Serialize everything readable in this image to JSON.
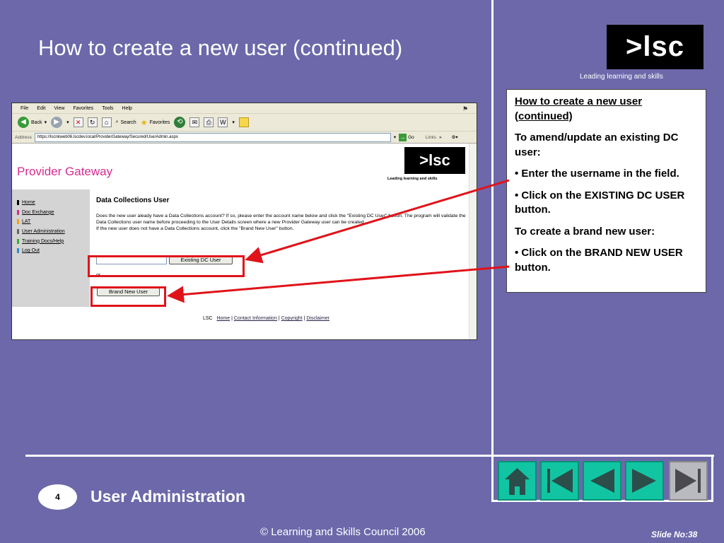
{
  "slide": {
    "title": "How to create a new user (continued)",
    "logo_text": ">lsc",
    "logo_tagline": "Leading learning and skills",
    "section_number": "4",
    "section_title": "User Administration",
    "copyright": "© Learning and Skills Council 2006",
    "slide_number": "Slide No:38"
  },
  "panel": {
    "heading": "How to create a new user (continued)",
    "amend_heading": "To amend/update an existing DC user:",
    "step1": "• Enter the username in the field.",
    "step2": "• Click on the EXISTING DC USER button.",
    "create_heading": "To create a brand new user:",
    "step3": "• Click on the BRAND NEW USER button."
  },
  "browser": {
    "menu": [
      "File",
      "Edit",
      "View",
      "Favorites",
      "Tools",
      "Help"
    ],
    "toolbar": {
      "back": "Back",
      "search": "Search",
      "favorites": "Favorites"
    },
    "address_label": "Address",
    "address_url": "https://lscnkweb06.lscdev.local/ProviderGateway/Secured/UserAdmin.aspx",
    "go_label": "Go",
    "links_label": "Links"
  },
  "webpage": {
    "title": "Provider Gateway",
    "logo_text": ">lsc",
    "logo_tagline": "Leading learning and skills",
    "nav": [
      {
        "label": "Home",
        "color": "#000000"
      },
      {
        "label": "Doc Exchange",
        "color": "#d62d8f"
      },
      {
        "label": "LAT",
        "color": "#f2a21b"
      },
      {
        "label": "User Administration",
        "color": "#666666"
      },
      {
        "label": "Training Docs/Help",
        "color": "#3aa93a"
      },
      {
        "label": "Log Out",
        "color": "#2a8fcf"
      }
    ],
    "section_title": "Data Collections User",
    "description_1": "Does the new user aleady have a Data Collections account? If so, please enter the account name below and click the \"Existing DC User\" button. The program will validate the Data Collections user name before proceeding to the User Details screen where a new Provider Gateway user can be created.",
    "description_2": "If the new user does not have a Data Collections account, click the \"Brand New User\" button.",
    "existing_button": "Existing DC User",
    "or_text": "or",
    "new_button": "Brand New User",
    "footer": {
      "org": "LSC",
      "links": [
        "Home",
        "Contact Information",
        "Copyright",
        "Disclaimer"
      ]
    }
  },
  "colors": {
    "background": "#6c68aa",
    "highlight": "#e0131a",
    "nav_button": "#11c5a3"
  }
}
